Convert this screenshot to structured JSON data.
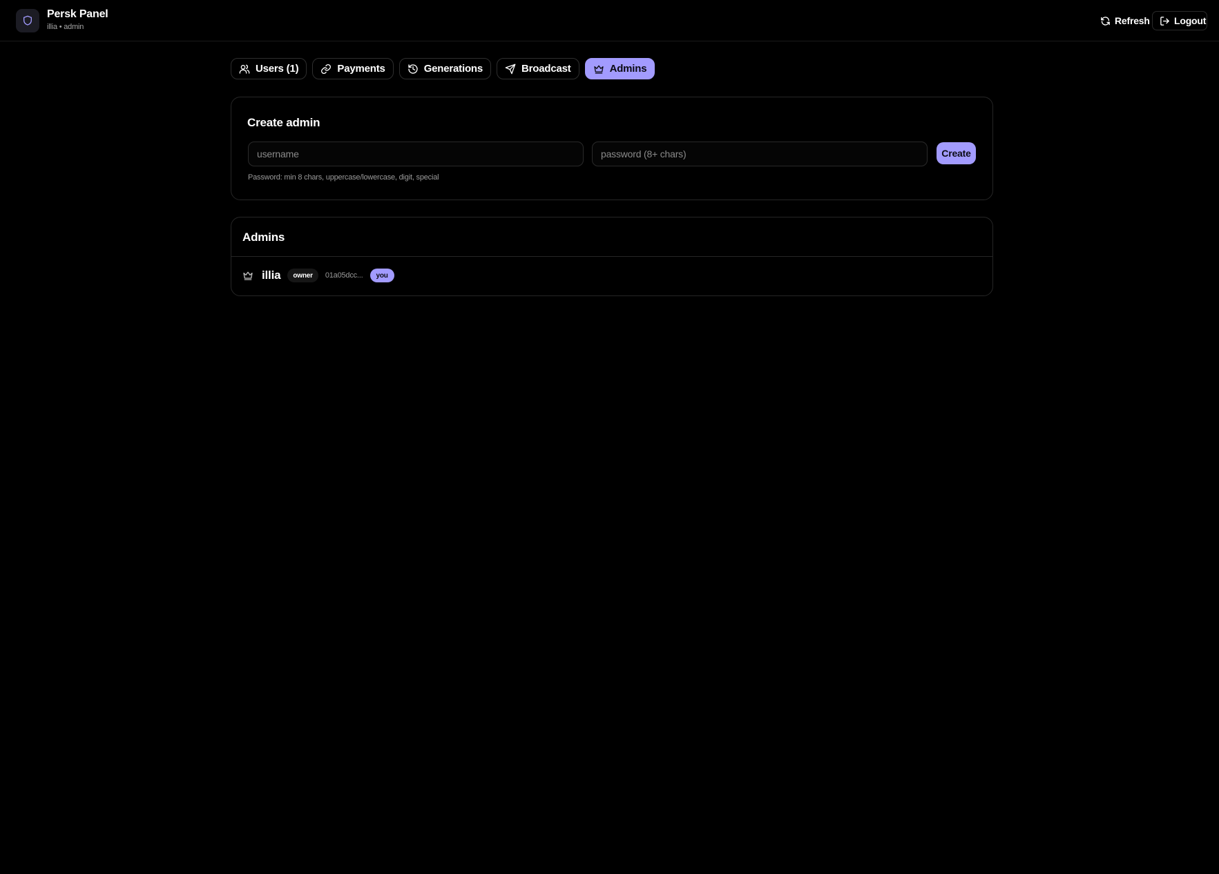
{
  "header": {
    "title": "Persk Panel",
    "subtitle": "illia • admin",
    "refresh_label": "Refresh",
    "logout_label": "Logout"
  },
  "tabs": [
    {
      "label": "Users (1)",
      "icon": "users-icon",
      "active": false
    },
    {
      "label": "Payments",
      "icon": "link-icon",
      "active": false
    },
    {
      "label": "Generations",
      "icon": "history-icon",
      "active": false
    },
    {
      "label": "Broadcast",
      "icon": "send-icon",
      "active": false
    },
    {
      "label": "Admins",
      "icon": "crown-icon",
      "active": true
    }
  ],
  "create_admin": {
    "title": "Create admin",
    "username_placeholder": "username",
    "password_placeholder": "password (8+ chars)",
    "create_label": "Create",
    "hint": "Password: min 8 chars, uppercase/lowercase, digit, special"
  },
  "admins": {
    "title": "Admins",
    "items": [
      {
        "name": "illia",
        "role": "owner",
        "id": "01a05dcc...",
        "badge": "you",
        "icon": "crown-icon"
      }
    ]
  },
  "colors": {
    "background": "#000000",
    "accent": "#a29bfe",
    "border": "#262626",
    "muted_text": "#9a9a9a"
  }
}
